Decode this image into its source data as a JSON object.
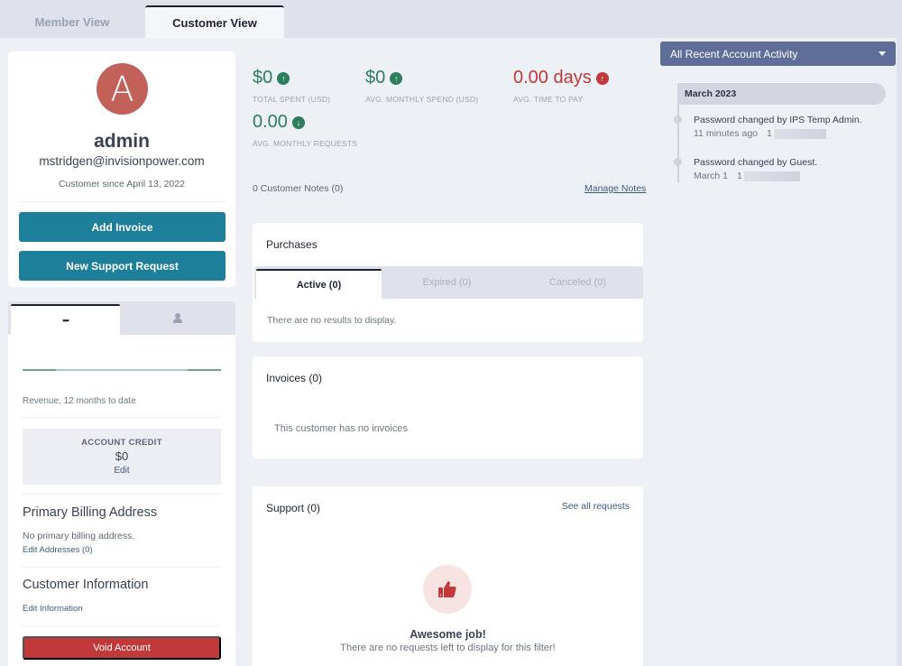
{
  "tabs": {
    "member_view": "Member View",
    "customer_view": "Customer View"
  },
  "profile": {
    "avatar_letter": "A",
    "name": "admin",
    "email": "mstridgen@invisionpower.com",
    "customer_since": "Customer since April 13, 2022",
    "add_invoice": "Add Invoice",
    "new_support_request": "New Support Request"
  },
  "detail": {
    "tab_overview_icon": "more-dots-icon",
    "tab_overview_label": "•••",
    "tab_user_icon": "user-icon",
    "revenue_label": "Revenue, 12 months to date",
    "account_credit_title": "ACCOUNT CREDIT",
    "account_credit_value": "$0",
    "account_credit_edit": "Edit",
    "billing_title": "Primary Billing Address",
    "billing_empty": "No primary billing address.",
    "edit_addresses": "Edit Addresses (0)",
    "customer_info_title": "Customer Information",
    "edit_information": "Edit Information",
    "void_account": "Void Account"
  },
  "stats": [
    {
      "value": "$0",
      "label": "TOTAL SPENT (USD)",
      "trend": "up",
      "color": "#2e7d5e"
    },
    {
      "value": "$0",
      "label": "AVG. MONTHLY SPEND (USD)",
      "trend": "up",
      "color": "#2e7d5e"
    },
    {
      "value": "0.00 days",
      "label": "AVG. TIME TO PAY",
      "trend": "up",
      "color": "#c1393a"
    },
    {
      "value": "0.00",
      "label": "AVG. MONTHLY REQUESTS",
      "trend": "down",
      "color": "#2e7d5e"
    }
  ],
  "notes": {
    "count_label": "0 Customer Notes (0)",
    "manage_link": "Manage Notes"
  },
  "purchases": {
    "title": "Purchases",
    "tabs": [
      "Active (0)",
      "Expired (0)",
      "Canceled (0)"
    ],
    "empty": "There are no results to display."
  },
  "invoices": {
    "title": "Invoices (0)",
    "empty": "This customer has no invoices"
  },
  "support": {
    "title": "Support (0)",
    "see_all": "See all requests",
    "empty_title": "Awesome job!",
    "empty_sub": "There are no requests left to display for this filter!"
  },
  "activity": {
    "filter": "All Recent Account Activity",
    "month": "March 2023",
    "events": [
      {
        "title": "Password changed by IPS Temp Admin.",
        "time": "11 minutes ago",
        "ip_prefix": "1"
      },
      {
        "title": "Password changed by Guest.",
        "time": "March 1",
        "ip_prefix": "1"
      }
    ]
  },
  "colors": {
    "teal_button": "#1e7f9a",
    "danger": "#c1393a",
    "success": "#2e7d5e",
    "activity_header": "#5f6e98"
  }
}
